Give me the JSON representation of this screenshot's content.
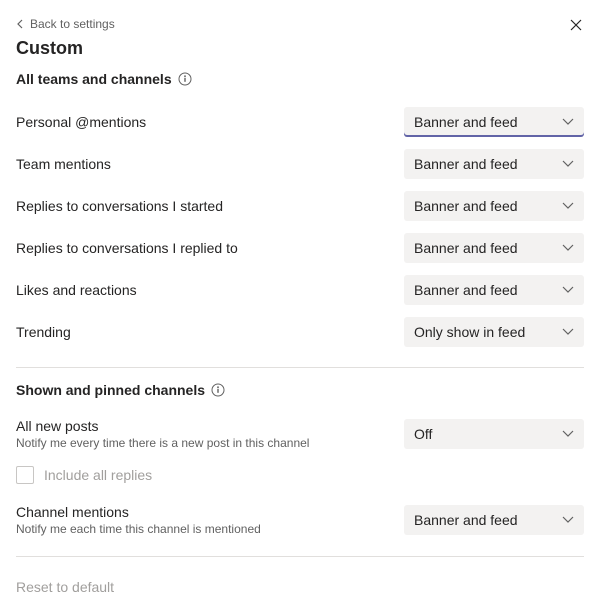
{
  "header": {
    "back_label": "Back to settings",
    "title": "Custom"
  },
  "section1": {
    "title": "All teams and channels",
    "rows": [
      {
        "label": "Personal @mentions",
        "value": "Banner and feed",
        "active": true
      },
      {
        "label": "Team mentions",
        "value": "Banner and feed",
        "active": false
      },
      {
        "label": "Replies to conversations I started",
        "value": "Banner and feed",
        "active": false
      },
      {
        "label": "Replies to conversations I replied to",
        "value": "Banner and feed",
        "active": false
      },
      {
        "label": "Likes and reactions",
        "value": "Banner and feed",
        "active": false
      },
      {
        "label": "Trending",
        "value": "Only show in feed",
        "active": false
      }
    ]
  },
  "section2": {
    "title": "Shown and pinned channels",
    "all_new_posts": {
      "label": "All new posts",
      "desc": "Notify me every time there is a new post in this channel",
      "value": "Off"
    },
    "include_replies_label": "Include all replies",
    "channel_mentions": {
      "label": "Channel mentions",
      "desc": "Notify me each time this channel is mentioned",
      "value": "Banner and feed"
    }
  },
  "reset_label": "Reset to default"
}
